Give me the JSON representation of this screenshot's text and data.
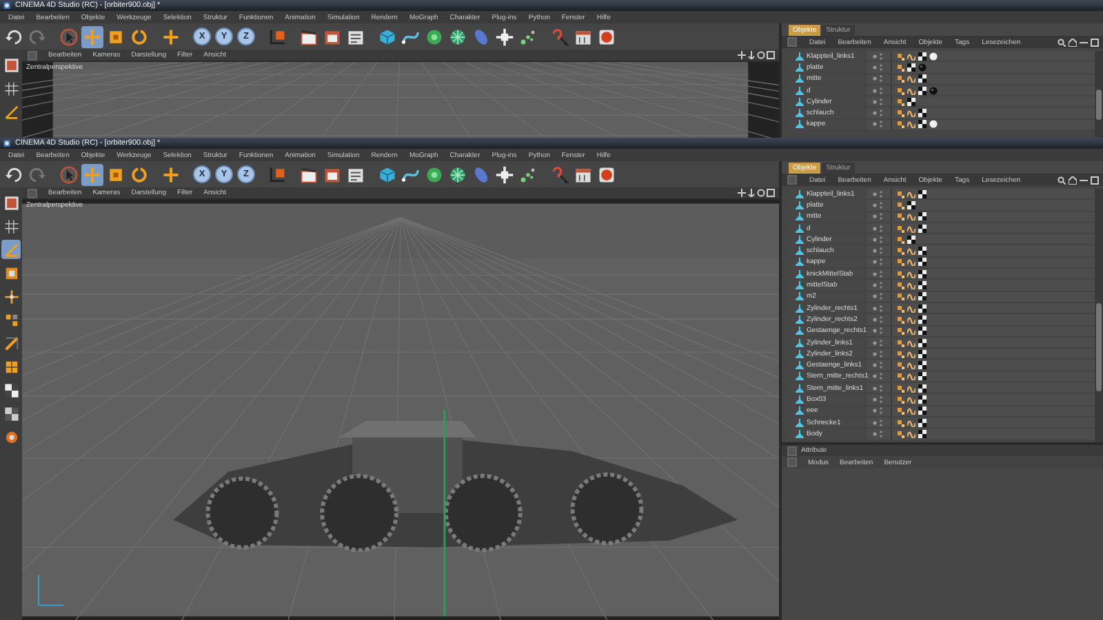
{
  "windows": [
    {
      "title": "CINEMA 4D Studio (RC) - [orbiter900.obj] *",
      "menu": [
        "Datei",
        "Bearbeiten",
        "Objekte",
        "Werkzeuge",
        "Selektion",
        "Struktur",
        "Funktionen",
        "Animation",
        "Simulation",
        "Rendern",
        "MoGraph",
        "Charakter",
        "Plug-ins",
        "Python",
        "Fenster",
        "Hilfe"
      ],
      "tools": [
        {
          "selected": false
        },
        {
          "selected": true
        },
        {
          "selected": false
        },
        {
          "selected": false
        }
      ],
      "axes": [
        {
          "label": "X",
          "on": true
        },
        {
          "label": "Y",
          "on": true
        },
        {
          "label": "Z",
          "on": true
        }
      ],
      "mode_buttons": [
        {
          "selected": false
        },
        {
          "selected": false
        },
        {
          "selected": false
        }
      ],
      "viewport": {
        "menu": [
          "Bearbeiten",
          "Kameras",
          "Darstellung",
          "Filter",
          "Ansicht"
        ],
        "camera": "Zentralperspektive"
      },
      "panel": {
        "tabs": [
          {
            "label": "Objekte",
            "selected": true
          },
          {
            "label": "Struktur",
            "selected": false
          }
        ],
        "menu": [
          "Datei",
          "Bearbeiten",
          "Ansicht",
          "Objekte",
          "Tags",
          "Lesezeichen"
        ],
        "objects": [
          {
            "name": "Klappteil_links1",
            "tags": [
              {
                "kind": "uvw"
              },
              {
                "kind": "phong"
              },
              {
                "kind": "texture"
              },
              {
                "kind": "material-light"
              }
            ]
          },
          {
            "name": "platte",
            "tags": [
              {
                "kind": "uvw"
              },
              {
                "kind": "texture"
              },
              {
                "kind": "material-dark"
              }
            ]
          },
          {
            "name": "mitte",
            "tags": [
              {
                "kind": "uvw"
              },
              {
                "kind": "phong"
              },
              {
                "kind": "texture"
              }
            ]
          },
          {
            "name": "d",
            "tags": [
              {
                "kind": "uvw"
              },
              {
                "kind": "phong"
              },
              {
                "kind": "texture"
              },
              {
                "kind": "material-dark"
              }
            ]
          },
          {
            "name": "Cylinder",
            "tags": [
              {
                "kind": "uvw"
              },
              {
                "kind": "texture"
              }
            ]
          },
          {
            "name": "schlauch",
            "tags": [
              {
                "kind": "uvw"
              },
              {
                "kind": "phong"
              },
              {
                "kind": "texture"
              }
            ]
          },
          {
            "name": "kappe",
            "tags": [
              {
                "kind": "uvw"
              },
              {
                "kind": "phong"
              },
              {
                "kind": "texture"
              },
              {
                "kind": "material-light"
              }
            ]
          }
        ]
      }
    },
    {
      "title": "CINEMA 4D Studio (RC) - [orbiter900.obj] *",
      "menu": [
        "Datei",
        "Bearbeiten",
        "Objekte",
        "Werkzeuge",
        "Selektion",
        "Struktur",
        "Funktionen",
        "Animation",
        "Simulation",
        "Rendern",
        "MoGraph",
        "Charakter",
        "Plug-ins",
        "Python",
        "Fenster",
        "Hilfe"
      ],
      "tools": [
        {
          "selected": false
        },
        {
          "selected": true
        },
        {
          "selected": false
        },
        {
          "selected": false
        }
      ],
      "axes": [
        {
          "label": "X",
          "on": true
        },
        {
          "label": "Y",
          "on": true
        },
        {
          "label": "Z",
          "on": true
        }
      ],
      "mode_buttons": [
        {
          "selected": false
        },
        {
          "selected": false
        },
        {
          "selected": true
        },
        {
          "selected": false
        },
        {
          "selected": false
        },
        {
          "selected": false
        },
        {
          "selected": false
        },
        {
          "selected": false
        },
        {
          "selected": false
        },
        {
          "selected": false
        },
        {
          "selected": false
        }
      ],
      "viewport": {
        "menu": [
          "Bearbeiten",
          "Kameras",
          "Darstellung",
          "Filter",
          "Ansicht"
        ],
        "camera": "Zentralperspektive"
      },
      "panel": {
        "tabs": [
          {
            "label": "Objekte",
            "selected": true
          },
          {
            "label": "Struktur",
            "selected": false
          }
        ],
        "menu": [
          "Datei",
          "Bearbeiten",
          "Ansicht",
          "Objekte",
          "Tags",
          "Lesezeichen"
        ],
        "objects": [
          {
            "name": "Klappteil_links1",
            "tags": [
              {
                "kind": "uvw"
              },
              {
                "kind": "phong"
              },
              {
                "kind": "texture"
              }
            ]
          },
          {
            "name": "platte",
            "tags": [
              {
                "kind": "uvw"
              },
              {
                "kind": "texture"
              }
            ]
          },
          {
            "name": "mitte",
            "tags": [
              {
                "kind": "uvw"
              },
              {
                "kind": "phong"
              },
              {
                "kind": "texture"
              }
            ]
          },
          {
            "name": "d",
            "tags": [
              {
                "kind": "uvw"
              },
              {
                "kind": "phong"
              },
              {
                "kind": "texture"
              }
            ]
          },
          {
            "name": "Cylinder",
            "tags": [
              {
                "kind": "uvw"
              },
              {
                "kind": "texture"
              }
            ]
          },
          {
            "name": "schlauch",
            "tags": [
              {
                "kind": "uvw"
              },
              {
                "kind": "phong"
              },
              {
                "kind": "texture"
              }
            ]
          },
          {
            "name": "kappe",
            "tags": [
              {
                "kind": "uvw"
              },
              {
                "kind": "phong"
              },
              {
                "kind": "texture"
              }
            ]
          },
          {
            "name": "knickMittelStab",
            "tags": [
              {
                "kind": "uvw"
              },
              {
                "kind": "phong"
              },
              {
                "kind": "texture"
              }
            ]
          },
          {
            "name": "mittelStab",
            "tags": [
              {
                "kind": "uvw"
              },
              {
                "kind": "phong"
              },
              {
                "kind": "texture"
              }
            ]
          },
          {
            "name": "m2",
            "tags": [
              {
                "kind": "uvw"
              },
              {
                "kind": "phong"
              },
              {
                "kind": "texture"
              }
            ]
          },
          {
            "name": "Zylinder_rechts1",
            "tags": [
              {
                "kind": "uvw"
              },
              {
                "kind": "phong"
              },
              {
                "kind": "texture"
              }
            ]
          },
          {
            "name": "Zylinder_rechts2",
            "tags": [
              {
                "kind": "uvw"
              },
              {
                "kind": "phong"
              },
              {
                "kind": "texture"
              }
            ]
          },
          {
            "name": "Gestaenge_rechts1",
            "tags": [
              {
                "kind": "uvw"
              },
              {
                "kind": "phong"
              },
              {
                "kind": "texture"
              }
            ]
          },
          {
            "name": "Zylinder_links1",
            "tags": [
              {
                "kind": "uvw"
              },
              {
                "kind": "phong"
              },
              {
                "kind": "texture"
              }
            ]
          },
          {
            "name": "Zylinder_links2",
            "tags": [
              {
                "kind": "uvw"
              },
              {
                "kind": "phong"
              },
              {
                "kind": "texture"
              }
            ]
          },
          {
            "name": "Gestaenge_links1",
            "tags": [
              {
                "kind": "uvw"
              },
              {
                "kind": "phong"
              },
              {
                "kind": "texture"
              }
            ]
          },
          {
            "name": "Stern_mitte_rechts1",
            "tags": [
              {
                "kind": "uvw"
              },
              {
                "kind": "phong"
              },
              {
                "kind": "texture"
              }
            ]
          },
          {
            "name": "Stern_mitte_links1",
            "tags": [
              {
                "kind": "uvw"
              },
              {
                "kind": "phong"
              },
              {
                "kind": "texture"
              }
            ]
          },
          {
            "name": "Box03",
            "tags": [
              {
                "kind": "uvw"
              },
              {
                "kind": "phong"
              },
              {
                "kind": "texture"
              }
            ]
          },
          {
            "name": "eee",
            "tags": [
              {
                "kind": "uvw"
              },
              {
                "kind": "phong"
              },
              {
                "kind": "texture"
              }
            ]
          },
          {
            "name": "Schnecke1",
            "tags": [
              {
                "kind": "uvw"
              },
              {
                "kind": "phong"
              },
              {
                "kind": "texture"
              }
            ]
          },
          {
            "name": "Body",
            "tags": [
              {
                "kind": "uvw"
              },
              {
                "kind": "phong"
              },
              {
                "kind": "texture"
              }
            ]
          }
        ]
      },
      "attributes": {
        "title": "Attribute",
        "menu": [
          "Modus",
          "Bearbeiten",
          "Benutzer"
        ]
      }
    }
  ]
}
